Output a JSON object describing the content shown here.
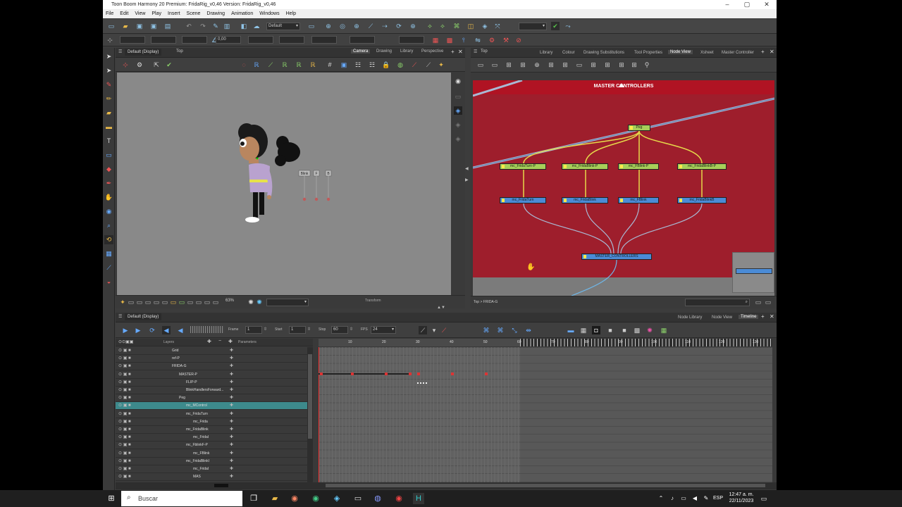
{
  "window": {
    "title": "Toon Boom Harmony 20 Premium: FridaRig_v0,46 Version: FridaRig_v0,46",
    "controls": [
      "–",
      "▢",
      "✕"
    ]
  },
  "menu": [
    "File",
    "Edit",
    "View",
    "Play",
    "Insert",
    "Scene",
    "Drawing",
    "Animation",
    "Windows",
    "Help"
  ],
  "toolbar": {
    "workspace": "Default",
    "value_field": "0,00"
  },
  "camera_view": {
    "preset": "Default (Display)",
    "breadcrumb": "Top",
    "tabs": [
      "Camera",
      "Drawing",
      "Library",
      "Perspective"
    ],
    "active_tab": "Camera",
    "sliders": [
      "Blink",
      "F",
      "B"
    ],
    "zoom": "63%",
    "mode": "Transform"
  },
  "node_view": {
    "breadcrumb": "Top",
    "tabs": [
      "Library",
      "Colour",
      "Drawing Substitutions",
      "Tool Properties",
      "Node View",
      "Xsheet",
      "Master Controller"
    ],
    "active_tab": "Node View",
    "backdrop_title": "MASTER CONTROLLERS",
    "nodes": {
      "peg": "Peg",
      "green": [
        "mc_FridaTurn-P",
        "mc_FridaBlink-P",
        "mc_FBlink-P",
        "mc_FridaBlinkB-P"
      ],
      "blue": [
        "mc_FridaTurn",
        "mc_FridaBlink",
        "mc_FBlink",
        "mc_FridaBlinkB"
      ],
      "composite": "MASTER_CONTROLLERS"
    },
    "path": "Top > FRIDA-G",
    "accent": "#9e1e2c"
  },
  "timeline": {
    "preset": "Default (Display)",
    "tabs": [
      "Node Library",
      "Node View",
      "Timeline"
    ],
    "active_tab": "Timeline",
    "frame_label": "Frame",
    "frame": "1",
    "start_label": "Start",
    "start": "1",
    "stop_label": "Stop",
    "stop": "60",
    "fps_label": "FPS",
    "fps": "24",
    "col_layers": "Layers",
    "col_params": "Parameters",
    "ruler": [
      "10",
      "20",
      "30",
      "40",
      "50",
      "60",
      "70",
      "80",
      "90",
      "100",
      "110",
      "120",
      "130"
    ],
    "layers": [
      {
        "name": "Grid",
        "indent": 0
      },
      {
        "name": "ref-P",
        "indent": 0
      },
      {
        "name": "FRIDA-G",
        "indent": 0
      },
      {
        "name": "MASTER-P",
        "indent": 1
      },
      {
        "name": "FLIP-P",
        "indent": 2
      },
      {
        "name": "BlinkHandlersForward...",
        "indent": 2
      },
      {
        "name": "Peg",
        "indent": 1
      },
      {
        "name": "mc_MControl",
        "indent": 2,
        "selected": true
      },
      {
        "name": "mc_FridaTurn",
        "indent": 2
      },
      {
        "name": "mc_Frida",
        "indent": 3
      },
      {
        "name": "mc_FridaBlink",
        "indent": 2
      },
      {
        "name": "mc_FridaI",
        "indent": 3
      },
      {
        "name": "mc_FblinkF-P",
        "indent": 2
      },
      {
        "name": "mc_FBlink",
        "indent": 3
      },
      {
        "name": "mc_FridaBlinkI",
        "indent": 2
      },
      {
        "name": "mc_FridaI",
        "indent": 3
      },
      {
        "name": "MAS",
        "indent": 3
      }
    ]
  },
  "taskbar": {
    "search_placeholder": "Buscar",
    "lang": "ESP",
    "time": "12:47 a. m.",
    "date": "22/11/2023"
  }
}
